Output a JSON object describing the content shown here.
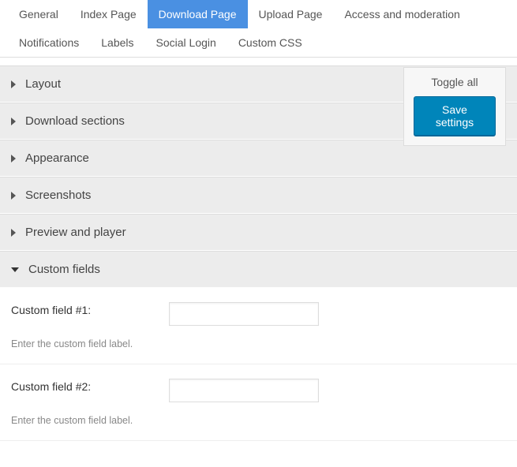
{
  "tabs": [
    {
      "label": "General"
    },
    {
      "label": "Index Page"
    },
    {
      "label": "Download Page"
    },
    {
      "label": "Upload Page"
    },
    {
      "label": "Access and moderation"
    },
    {
      "label": "Notifications"
    },
    {
      "label": "Labels"
    },
    {
      "label": "Social Login"
    },
    {
      "label": "Custom CSS"
    }
  ],
  "active_tab_index": 2,
  "actions": {
    "toggle_all": "Toggle all",
    "save": "Save settings"
  },
  "sections": [
    {
      "title": "Layout",
      "expanded": false
    },
    {
      "title": "Download sections",
      "expanded": false
    },
    {
      "title": "Appearance",
      "expanded": false
    },
    {
      "title": "Screenshots",
      "expanded": false
    },
    {
      "title": "Preview and player",
      "expanded": false
    },
    {
      "title": "Custom fields",
      "expanded": true
    }
  ],
  "custom_fields": [
    {
      "label": "Custom field #1:",
      "value": "",
      "hint": "Enter the custom field label."
    },
    {
      "label": "Custom field #2:",
      "value": "",
      "hint": "Enter the custom field label."
    }
  ]
}
